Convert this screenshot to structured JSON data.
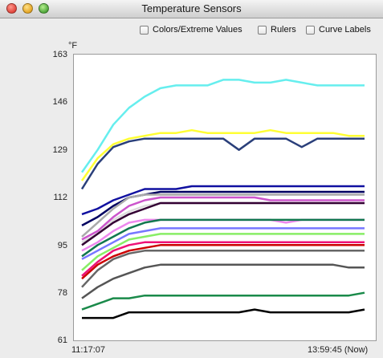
{
  "window": {
    "title": "Temperature Sensors"
  },
  "options": {
    "colors_extreme": "Colors/Extreme Values",
    "rulers": "Rulers",
    "curve_labels": "Curve Labels"
  },
  "chart_data": {
    "type": "line",
    "unit": "°F",
    "y_ticks": [
      "163",
      "146",
      "129",
      "112",
      "95",
      "78",
      "61"
    ],
    "ylim": [
      61,
      163
    ],
    "x_start_label": "11:17:07",
    "x_end_label": "13:59:45 (Now)",
    "grid": false,
    "legend": "none",
    "series": [
      {
        "color": "#66eeee",
        "values": [
          121,
          129,
          138,
          144,
          148,
          151,
          152,
          152,
          152,
          154,
          154,
          153,
          153,
          154,
          153,
          152,
          152,
          152,
          152
        ]
      },
      {
        "color": "#ffff33",
        "values": [
          118,
          126,
          131,
          133,
          134,
          135,
          135,
          136,
          135,
          135,
          135,
          135,
          136,
          135,
          135,
          135,
          135,
          134,
          134
        ]
      },
      {
        "color": "#2a3f7a",
        "values": [
          115,
          124,
          130,
          132,
          133,
          133,
          133,
          133,
          133,
          133,
          129,
          133,
          133,
          133,
          130,
          133,
          133,
          133,
          133
        ]
      },
      {
        "color": "#1010a0",
        "values": [
          106,
          108,
          111,
          113,
          115,
          115,
          115,
          116,
          116,
          116,
          116,
          116,
          116,
          116,
          116,
          116,
          116,
          116,
          116
        ]
      },
      {
        "color": "#000060",
        "values": [
          102,
          105,
          109,
          112,
          113,
          114,
          114,
          114,
          114,
          114,
          114,
          114,
          114,
          114,
          114,
          114,
          114,
          114,
          114
        ]
      },
      {
        "color": "#aaaaaa",
        "values": [
          98,
          103,
          108,
          112,
          113,
          113,
          113,
          113,
          113,
          113,
          113,
          113,
          113,
          113,
          113,
          113,
          113,
          113,
          113
        ]
      },
      {
        "color": "#cc55cc",
        "values": [
          97,
          100,
          105,
          109,
          111,
          112,
          112,
          112,
          112,
          112,
          112,
          112,
          111,
          111,
          111,
          111,
          111,
          111,
          111
        ]
      },
      {
        "color": "#dddddd",
        "values": [
          96,
          99,
          104,
          107,
          109,
          110,
          110,
          110,
          110,
          110,
          110,
          110,
          110,
          110,
          110,
          110,
          110,
          110,
          110
        ]
      },
      {
        "color": "#330033",
        "values": [
          95,
          99,
          103,
          106,
          108,
          110,
          110,
          110,
          110,
          110,
          110,
          110,
          110,
          110,
          110,
          110,
          110,
          110,
          110
        ]
      },
      {
        "color": "#ee88ee",
        "values": [
          93,
          96,
          100,
          103,
          104,
          104,
          104,
          104,
          104,
          104,
          104,
          104,
          104,
          103,
          104,
          104,
          104,
          104,
          104
        ]
      },
      {
        "color": "#11774f",
        "values": [
          91,
          95,
          98,
          101,
          103,
          104,
          104,
          104,
          104,
          104,
          104,
          104,
          104,
          104,
          104,
          104,
          104,
          104,
          104
        ]
      },
      {
        "color": "#7777ff",
        "values": [
          90,
          93,
          96,
          99,
          100,
          101,
          101,
          101,
          101,
          101,
          101,
          101,
          101,
          101,
          101,
          101,
          101,
          101,
          101
        ]
      },
      {
        "color": "#88ee66",
        "values": [
          86,
          91,
          94,
          97,
          98,
          99,
          99,
          99,
          99,
          99,
          99,
          99,
          99,
          99,
          99,
          99,
          99,
          99,
          99
        ]
      },
      {
        "color": "#ee1177",
        "values": [
          84,
          89,
          93,
          95,
          96,
          96,
          96,
          96,
          96,
          96,
          96,
          96,
          96,
          96,
          96,
          96,
          96,
          96,
          96
        ]
      },
      {
        "color": "#cc0000",
        "values": [
          83,
          88,
          91,
          93,
          94,
          95,
          95,
          95,
          95,
          95,
          95,
          95,
          95,
          95,
          95,
          95,
          95,
          95,
          95
        ]
      },
      {
        "color": "#666666",
        "values": [
          80,
          86,
          90,
          92,
          93,
          93,
          93,
          93,
          93,
          93,
          93,
          93,
          93,
          93,
          93,
          93,
          93,
          93,
          93
        ]
      },
      {
        "color": "#555555",
        "values": [
          76,
          80,
          83,
          85,
          87,
          88,
          88,
          88,
          88,
          88,
          88,
          88,
          88,
          88,
          88,
          88,
          88,
          87,
          87
        ]
      },
      {
        "color": "#1a8a4a",
        "values": [
          72,
          74,
          76,
          76,
          77,
          77,
          77,
          77,
          77,
          77,
          77,
          77,
          77,
          77,
          77,
          77,
          77,
          77,
          78
        ]
      },
      {
        "color": "#000000",
        "values": [
          69,
          69,
          69,
          71,
          71,
          71,
          71,
          71,
          71,
          71,
          71,
          72,
          71,
          71,
          71,
          71,
          71,
          71,
          72
        ]
      }
    ]
  }
}
